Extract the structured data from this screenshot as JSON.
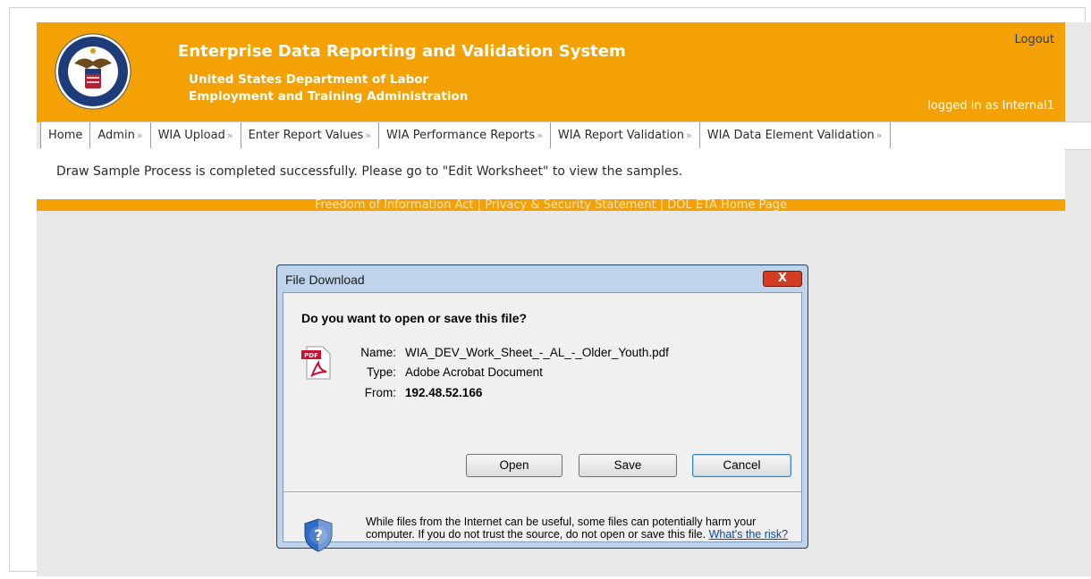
{
  "header": {
    "title": "Enterprise Data Reporting and Validation System",
    "subtitle1": "United States Department of Labor",
    "subtitle2": "Employment and Training Administration",
    "logout": "Logout",
    "logged_in": "logged in as Internal1"
  },
  "nav": {
    "items": [
      {
        "label": "Home"
      },
      {
        "label": "Admin",
        "arrow": "»"
      },
      {
        "label": "WIA Upload",
        "arrow": "»"
      },
      {
        "label": "Enter Report Values",
        "arrow": "»"
      },
      {
        "label": "WIA Performance Reports",
        "arrow": "»"
      },
      {
        "label": "WIA Report Validation",
        "arrow": "»"
      },
      {
        "label": "WIA Data Element Validation",
        "arrow": "»"
      }
    ]
  },
  "message": "Draw Sample Process is completed successfully. Please go to \"Edit Worksheet\" to view the samples.",
  "footer": {
    "links": [
      "Freedom of Information Act",
      "Privacy & Security Statement",
      "DOL ETA Home Page"
    ],
    "separator": "|"
  },
  "dialog": {
    "title": "File Download",
    "close": "X",
    "question": "Do you want to open or save this file?",
    "pdf_icon_text": "PDF",
    "name_label": "Name:",
    "name_value": "WIA_DEV_Work_Sheet_-_AL_-_Older_Youth.pdf",
    "type_label": "Type:",
    "type_value": "Adobe Acrobat Document",
    "from_label": "From:",
    "from_value": "192.48.52.166",
    "buttons": {
      "open": "Open",
      "save": "Save",
      "cancel": "Cancel"
    },
    "warning_text": "While files from the Internet can be useful, some files can potentially harm your computer. If you do not trust the source, do not open or save this file.",
    "warning_link": "What's the risk?"
  },
  "colors": {
    "header_bg": "#f3a105",
    "page_bg": "#e8e8e8",
    "dialog_frame": "#bfd4ea",
    "close_button": "#d23c22",
    "link": "#0645ad"
  }
}
